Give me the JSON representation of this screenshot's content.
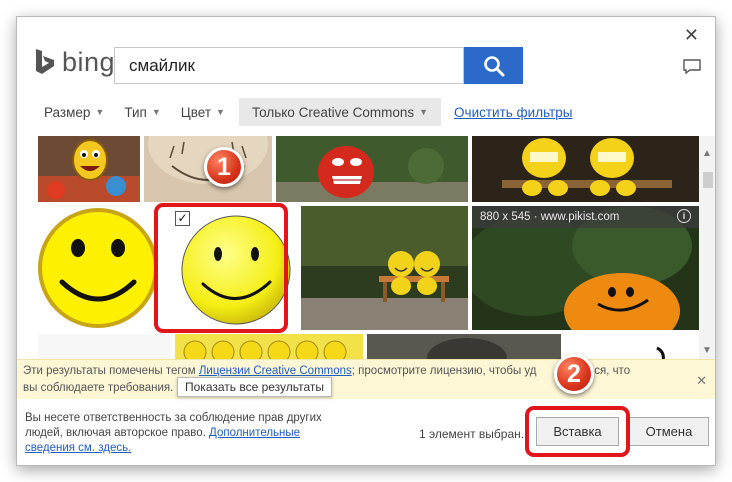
{
  "dialog": {
    "close_glyph": "✕",
    "brand": "bing",
    "search": {
      "value": "смайлик"
    }
  },
  "filters": [
    {
      "label": "Размер"
    },
    {
      "label": "Тип"
    },
    {
      "label": "Цвет"
    },
    {
      "label": "Только Creative Commons"
    }
  ],
  "filters_clear": "Очистить фильтры",
  "results": {
    "hover_info": "880 x 545 · www.pikist.com",
    "info_glyph": "i",
    "check_glyph": "✓"
  },
  "callouts": [
    {
      "number": "1"
    },
    {
      "number": "2"
    }
  ],
  "notice": {
    "text_before": "Эти результаты помечены тегом ",
    "link": "Лицензии Creative Commons",
    "text_after": "; просмотрите лицензию, чтобы уд",
    "text_tail": "иться, что",
    "line2": "вы соблюдаете требования.",
    "tooltip": "Показать все результаты",
    "close_glyph": "✕"
  },
  "footer": {
    "disclaimer": "Вы несете ответственность за соблюдение прав других людей, включая авторское право. ",
    "more_link": "Дополнительные сведения см. здесь.",
    "selected_count": "1 элемент выбран.",
    "insert_label": "Вставка",
    "cancel_label": "Отмена"
  },
  "colors": {
    "accent": "#2b6ac9",
    "highlight": "#e1161b",
    "link": "#1f5fbf"
  }
}
